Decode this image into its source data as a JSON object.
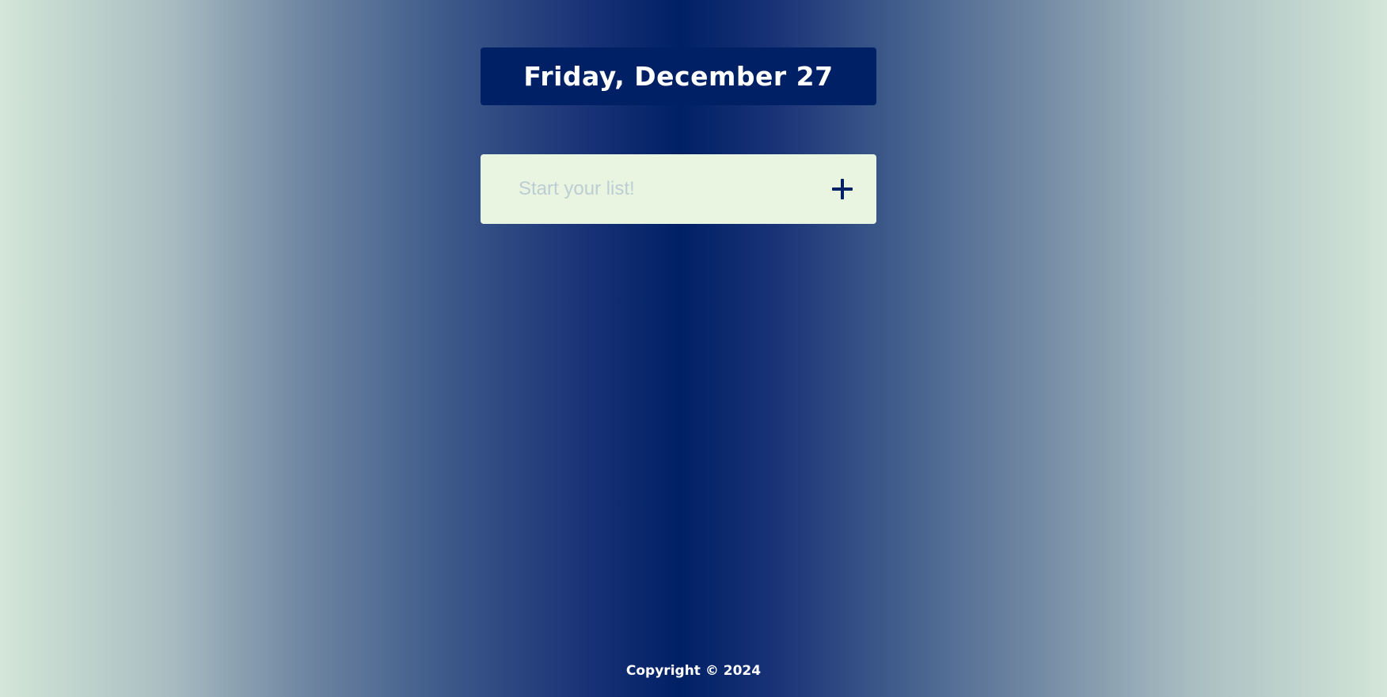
{
  "header": {
    "date": "Friday, December 27"
  },
  "todo": {
    "placeholder": "Start your list!",
    "value": "",
    "add_icon": "plus-icon"
  },
  "footer": {
    "copyright": "Copyright © 2024"
  },
  "colors": {
    "primary": "#002066",
    "input_bg": "#e9f5e1",
    "edge": "#d4e6d8",
    "text_light": "#ffffff",
    "placeholder": "#bccdd4"
  }
}
